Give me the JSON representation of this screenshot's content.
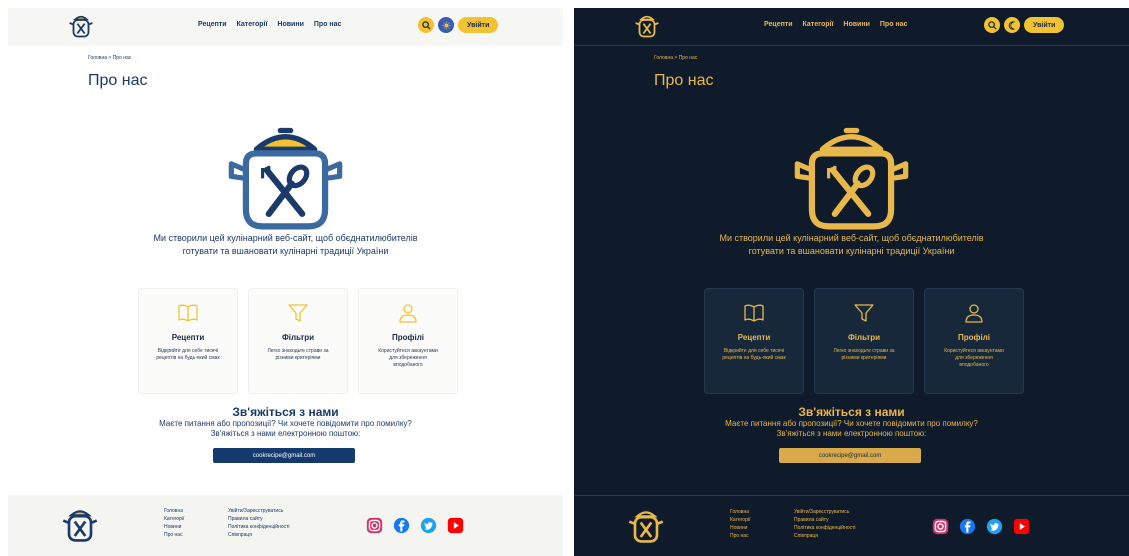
{
  "nav": [
    "Рецепти",
    "Категорії",
    "Новини",
    "Про нас"
  ],
  "login_label": "Увійти",
  "breadcrumb": "Головна > Про нас",
  "page_title": "Про нас",
  "intro": "Ми створили цей кулінарний веб-сайт, щоб обєднатилюбителів готувати та вшановати кулінарні традиції України",
  "cards": [
    {
      "icon": "book-icon",
      "title": "Рецепти",
      "desc": "Відкрийте для себе тисячі рецептів на будь-який смак"
    },
    {
      "icon": "filter-icon",
      "title": "Фільтри",
      "desc": "Легко знаходьте страви за різними критеріями"
    },
    {
      "icon": "user-icon",
      "title": "Профілі",
      "desc": "Користуйтеся аккаунтами для збереження вподобаного"
    }
  ],
  "contact": {
    "heading": "Зв'яжіться з нами",
    "text": "Маєте питання або пропозиції? Чи хочете повідомити про помилку? Зв'яжіться з нами електронною поштою:",
    "email": "cookrecipe@gmail.com"
  },
  "footer": {
    "col1": [
      "Головна",
      "Категорії",
      "Новини",
      "Про нас"
    ],
    "col2": [
      "Увійти/Зареєструватись",
      "Правила сайту",
      "Політика конфіденційності",
      "Співпраця"
    ]
  },
  "colors": {
    "light_bg": "#ffffff",
    "dark_bg": "#0f1b2b",
    "navy": "#1a3a6b",
    "accent_yellow": "#f3c230",
    "dark_accent": "#e8b84a"
  },
  "socials": [
    "instagram-icon",
    "facebook-icon",
    "twitter-icon",
    "youtube-icon"
  ]
}
